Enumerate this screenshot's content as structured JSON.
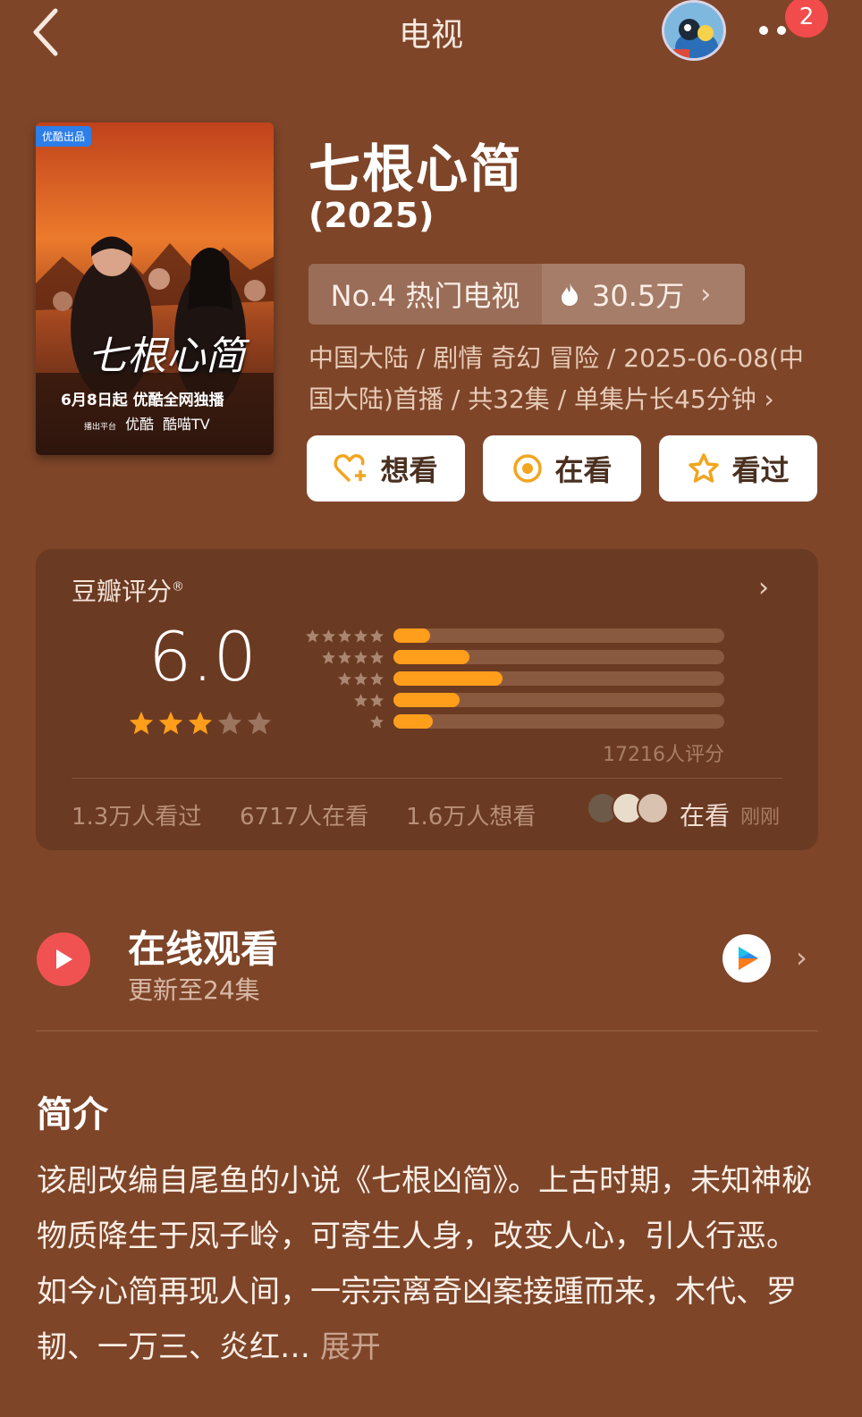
{
  "header": {
    "title": "电视",
    "notification_count": "2"
  },
  "poster": {
    "badge": "优酷出品",
    "title": "七根心简",
    "promo_line": "6月8日起 优酷全网独播",
    "platform_prefix": "播出平台",
    "platform_1": "优酷",
    "platform_2": "酷喵TV"
  },
  "show": {
    "title": "七根心简",
    "year": "(2025)",
    "rank_label": "No.4 热门电视",
    "heat": "30.5万",
    "meta_text": "中国大陆 / 剧情 奇幻 冒险 / 2025-06-08(中国大陆)首播 / 共32集 / 单集片长45分钟 ›"
  },
  "actions": {
    "want": "想看",
    "watching": "在看",
    "watched": "看过"
  },
  "rating": {
    "label": "豆瓣评分",
    "registered": "®",
    "score": "6.0",
    "stars_filled": 3,
    "stars_total": 5,
    "count_text": "17216人评分",
    "distribution": [
      {
        "stars": 5,
        "fraction": 0.11
      },
      {
        "stars": 4,
        "fraction": 0.23
      },
      {
        "stars": 3,
        "fraction": 0.33
      },
      {
        "stars": 2,
        "fraction": 0.2
      },
      {
        "stars": 1,
        "fraction": 0.12
      }
    ],
    "watched_count": "1.3万人看过",
    "watching_count": "6717人在看",
    "want_count": "1.6万人想看",
    "friend_status": "在看",
    "friend_time": "刚刚"
  },
  "online": {
    "title": "在线观看",
    "subtitle": "更新至24集"
  },
  "synopsis": {
    "title": "简介",
    "text": "该剧改编自尾鱼的小说《七根凶简》。上古时期，未知神秘物质降生于凤子岭，可寄生人身，改变人心，引人行恶。如今心简再现人间，一宗宗离奇凶案接踵而来，木代、罗韧、一万三、炎红…",
    "expand": "展开"
  },
  "colors": {
    "background": "#7e4529",
    "card": "#6b3a22",
    "accent_bar": "#ff9e1b",
    "play_red": "#f05252",
    "badge_red": "#f24b4b"
  }
}
